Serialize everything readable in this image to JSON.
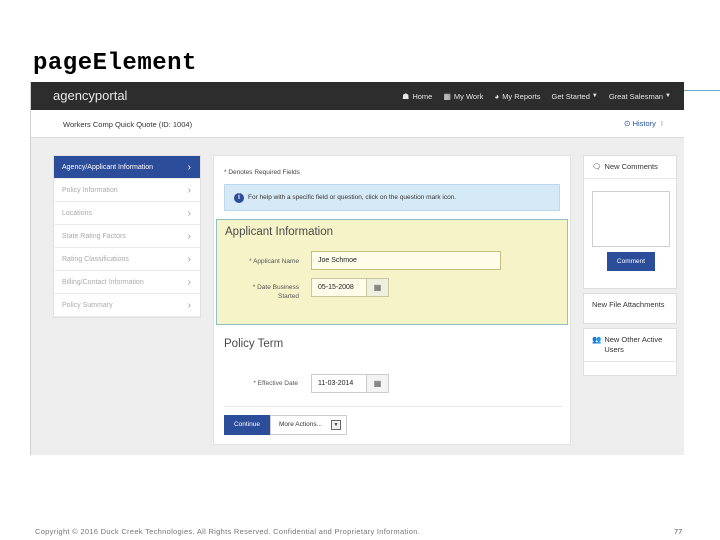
{
  "slide": {
    "title": "pageElement",
    "footer": "Copyright © 2016 Duck Creek Technologies. All Rights Reserved. Confidential and Proprietary Information.",
    "page_number": "77"
  },
  "topnav": {
    "brand": "agencyportal",
    "items": [
      {
        "label": "Home",
        "icon": "home-icon",
        "glyph": "☗"
      },
      {
        "label": "My Work",
        "icon": "grid-icon",
        "glyph": "▦"
      },
      {
        "label": "My Reports",
        "icon": "pie-chart-icon",
        "glyph": "◕"
      },
      {
        "label": "Get Started",
        "icon": "chevron-down-icon",
        "caret": "▼"
      },
      {
        "label": "Great Salesman",
        "icon": "chevron-down-icon",
        "caret": "▼"
      }
    ]
  },
  "quotebar": {
    "title": "Workers Comp Quick Quote (ID: 1004)",
    "history_label": "History",
    "history_icon": "clock-icon",
    "history_sep": "I"
  },
  "sidenav": {
    "items": [
      {
        "label": "Agency/Applicant Information",
        "active": true
      },
      {
        "label": "Policy Information",
        "active": false
      },
      {
        "label": "Locations",
        "active": false
      },
      {
        "label": "State Rating Factors",
        "active": false
      },
      {
        "label": "Rating Classifications",
        "active": false
      },
      {
        "label": "Billing/Contact Information",
        "active": false
      },
      {
        "label": "Policy Summary",
        "active": false
      }
    ],
    "chevron": "›"
  },
  "main": {
    "required_note": "* Denotes Required Fields",
    "help_text": "For help with a specific field or question, click on the question mark icon.",
    "help_icon": "info-icon",
    "applicant": {
      "title": "Applicant Information",
      "name_label": "* Applicant Name",
      "name_value": "Joe Schmoe",
      "date_label_line1": "* Date Business",
      "date_label_line2": "Started",
      "date_value": "05-15-2008"
    },
    "policy": {
      "title": "Policy Term",
      "effective_label": "* Effective Date",
      "effective_value": "11-03-2014"
    },
    "continue_label": "Continue",
    "more_label": "More Actions...",
    "more_caret": "▼",
    "calendar_glyph": "▦"
  },
  "right": {
    "comments_title": "New Comments",
    "comments_icon": "comment-icon",
    "comment_button": "Comment",
    "attachments_title": "New File Attachments",
    "users_title": "New Other Active Users",
    "users_icon": "users-icon"
  },
  "colors": {
    "accent": "#2c4d9a",
    "highlight": "#f5f3c7",
    "nav_bg": "#2d2d2d"
  }
}
